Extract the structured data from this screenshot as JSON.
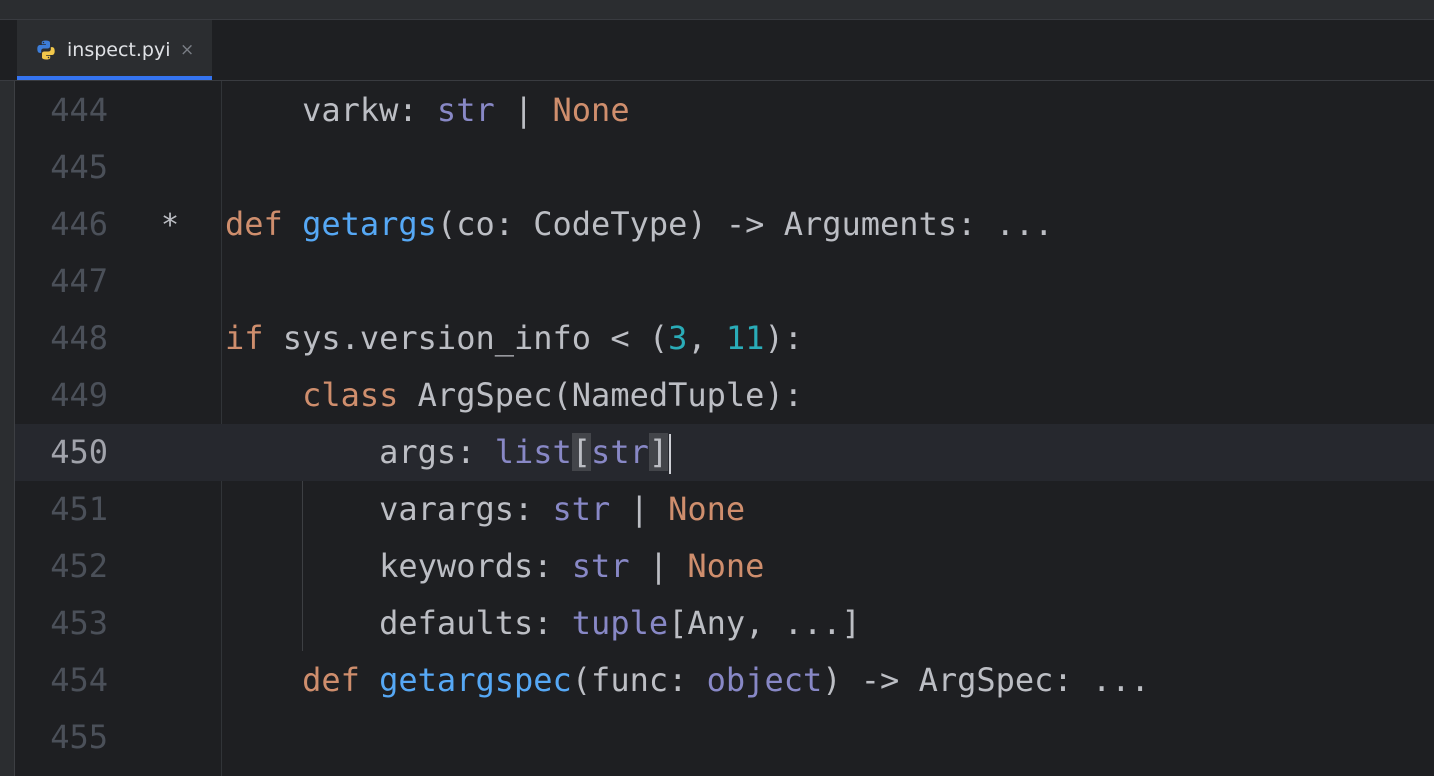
{
  "tab": {
    "filename": "inspect.pyi",
    "icon": "python-file-icon",
    "close_symbol": "×"
  },
  "colors": {
    "background": "#1e1f22",
    "keyword": "#cf8e6d",
    "function": "#56a8f5",
    "builtin": "#8888c6",
    "number": "#2aacb8",
    "default_text": "#bcbec4",
    "line_number": "#4b5059",
    "active_tab_underline": "#3574f0"
  },
  "current_line": 450,
  "lines": [
    {
      "number": "444",
      "marker": "",
      "tokens": [
        {
          "t": "    varkw: ",
          "c": ""
        },
        {
          "t": "str",
          "c": "bi"
        },
        {
          "t": " | ",
          "c": ""
        },
        {
          "t": "None",
          "c": "kw"
        }
      ]
    },
    {
      "number": "445",
      "marker": "",
      "tokens": []
    },
    {
      "number": "446",
      "marker": "*",
      "tokens": [
        {
          "t": "def",
          "c": "kw"
        },
        {
          "t": " ",
          "c": ""
        },
        {
          "t": "getargs",
          "c": "fn"
        },
        {
          "t": "(co: CodeType) -> Arguments: ...",
          "c": ""
        }
      ]
    },
    {
      "number": "447",
      "marker": "",
      "tokens": []
    },
    {
      "number": "448",
      "marker": "",
      "tokens": [
        {
          "t": "if",
          "c": "kw"
        },
        {
          "t": " sys.version_info < (",
          "c": ""
        },
        {
          "t": "3",
          "c": "num"
        },
        {
          "t": ", ",
          "c": ""
        },
        {
          "t": "11",
          "c": "num"
        },
        {
          "t": "):",
          "c": ""
        }
      ]
    },
    {
      "number": "449",
      "marker": "",
      "tokens": [
        {
          "t": "    ",
          "c": ""
        },
        {
          "t": "class",
          "c": "kw"
        },
        {
          "t": " ArgSpec(NamedTuple):",
          "c": ""
        }
      ]
    },
    {
      "number": "450",
      "marker": "",
      "tokens": [
        {
          "t": "        args: ",
          "c": ""
        },
        {
          "t": "list",
          "c": "bi"
        },
        {
          "t": "[",
          "c": "br-hl"
        },
        {
          "t": "str",
          "c": "bi"
        },
        {
          "t": "]",
          "c": "br-hl"
        }
      ]
    },
    {
      "number": "451",
      "marker": "",
      "tokens": [
        {
          "t": "        varargs: ",
          "c": ""
        },
        {
          "t": "str",
          "c": "bi"
        },
        {
          "t": " | ",
          "c": ""
        },
        {
          "t": "None",
          "c": "kw"
        }
      ]
    },
    {
      "number": "452",
      "marker": "",
      "tokens": [
        {
          "t": "        keywords: ",
          "c": ""
        },
        {
          "t": "str",
          "c": "bi"
        },
        {
          "t": " | ",
          "c": ""
        },
        {
          "t": "None",
          "c": "kw"
        }
      ]
    },
    {
      "number": "453",
      "marker": "",
      "tokens": [
        {
          "t": "        defaults: ",
          "c": ""
        },
        {
          "t": "tuple",
          "c": "bi"
        },
        {
          "t": "[Any, ...]",
          "c": ""
        }
      ]
    },
    {
      "number": "454",
      "marker": "",
      "tokens": [
        {
          "t": "    ",
          "c": ""
        },
        {
          "t": "def",
          "c": "kw"
        },
        {
          "t": " ",
          "c": ""
        },
        {
          "t": "getargspec",
          "c": "fn"
        },
        {
          "t": "(func: ",
          "c": ""
        },
        {
          "t": "object",
          "c": "bi"
        },
        {
          "t": ") -> ArgSpec: ...",
          "c": ""
        }
      ]
    },
    {
      "number": "455",
      "marker": "",
      "tokens": []
    }
  ]
}
